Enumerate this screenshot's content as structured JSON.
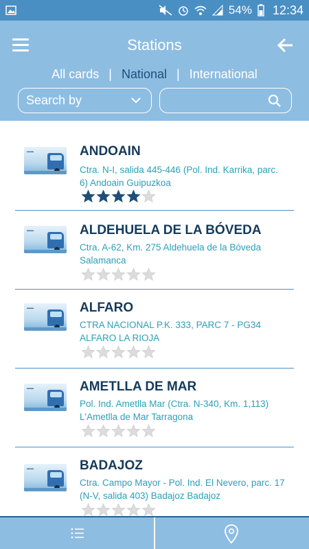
{
  "status_bar": {
    "battery": "54%",
    "time": "12:34"
  },
  "header": {
    "title": "Stations",
    "tabs": [
      {
        "label": "All cards",
        "active": false
      },
      {
        "label": "National",
        "active": true
      },
      {
        "label": "International",
        "active": false
      }
    ],
    "separator": "|",
    "search_by_label": "Search by",
    "search_value": ""
  },
  "stations": [
    {
      "name": "ANDOAIN",
      "address": "Ctra. N-I, salida 445-446 (Pol. Ind. Karrika, parc. 6) Andoain Guipuzkoa",
      "rating": 4
    },
    {
      "name": "ALDEHUELA DE LA BÓVEDA",
      "address": "Ctra. A-62, Km. 275 Aldehuela de la Bóveda Salamanca",
      "rating": 0
    },
    {
      "name": "ALFARO",
      "address": "CTRA NACIONAL P.K. 333, PARC 7 - PG34 ALFARO LA RIOJA",
      "rating": 0
    },
    {
      "name": "AMETLLA DE MAR",
      "address": "Pol. Ind. Ametlla Mar (Ctra. N-340, Km. 1,113) L'Ametlla de Mar Tarragona",
      "rating": 0
    },
    {
      "name": "BADAJOZ",
      "address": "Ctra. Campo Mayor - Pol. Ind. El Nevero, parc. 17 (N-V, salida 403) Badajoz Badajoz",
      "rating": 0
    }
  ],
  "colors": {
    "header_bg": "#8ebde2",
    "status_bg": "#4a8fc4",
    "station_name": "#143a5c",
    "address": "#2c9fb8",
    "star_filled": "#1d4f7a",
    "star_empty": "#dcdcdc"
  },
  "icons": {
    "menu": "hamburger-icon",
    "back": "arrow-left-icon",
    "dropdown": "chevron-down-icon",
    "search": "search-icon",
    "list": "list-icon",
    "map": "map-pin-icon"
  }
}
